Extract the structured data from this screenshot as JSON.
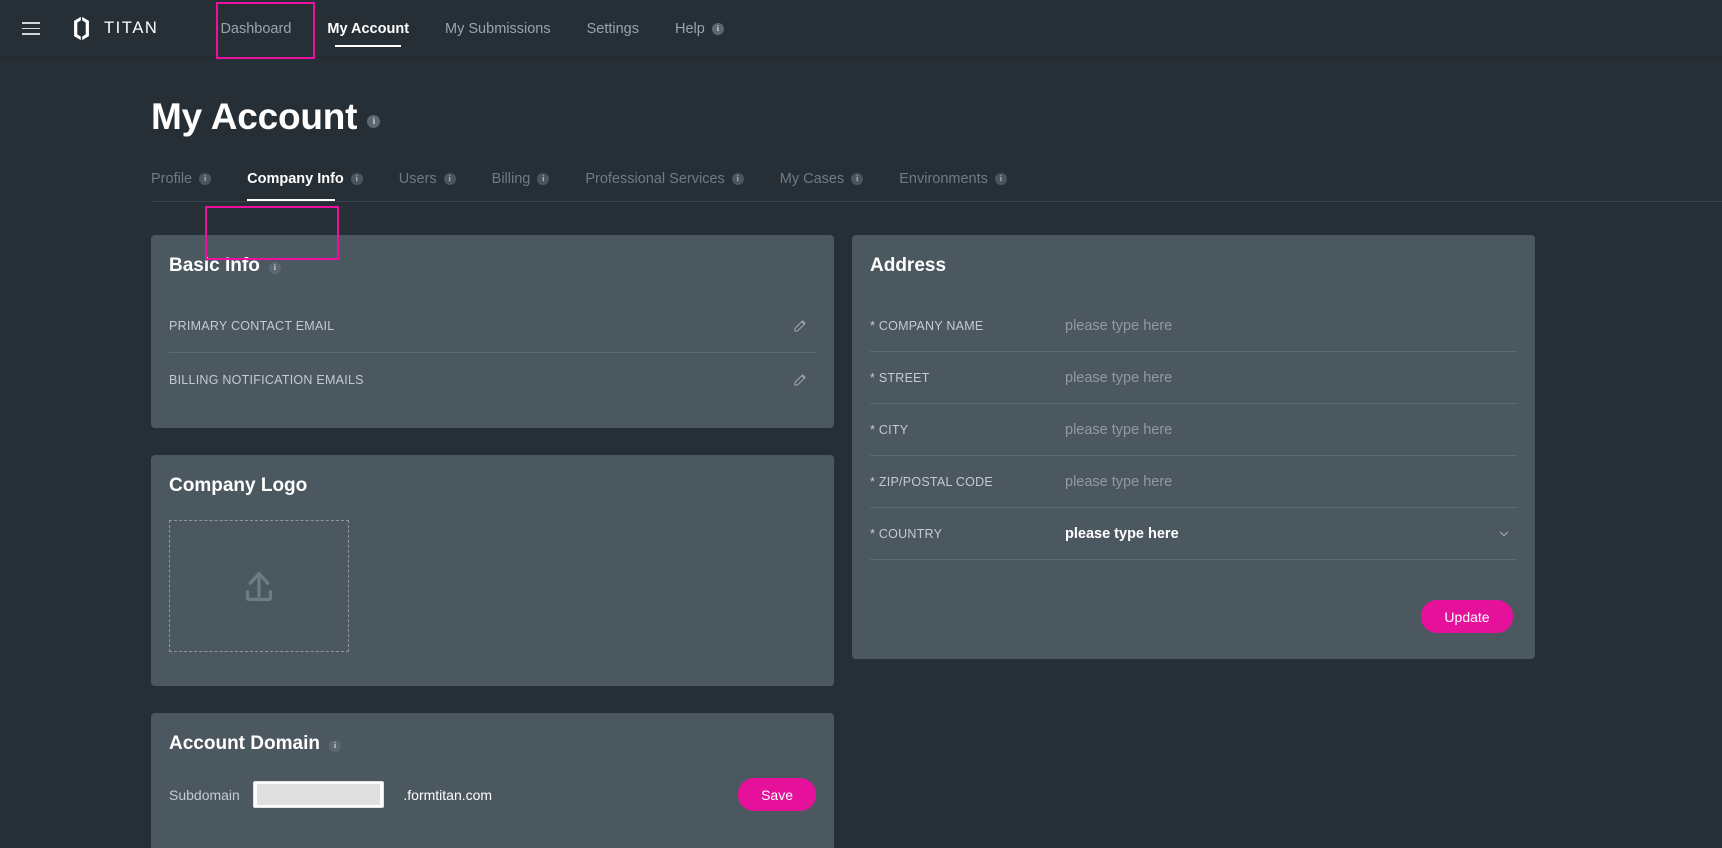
{
  "topnav": {
    "brand": "TITAN",
    "menu_icon": "hamburger-icon",
    "links": [
      {
        "label": "Dashboard",
        "active": false,
        "info": false
      },
      {
        "label": "My Account",
        "active": true,
        "info": false
      },
      {
        "label": "My Submissions",
        "active": false,
        "info": false
      },
      {
        "label": "Settings",
        "active": false,
        "info": false
      },
      {
        "label": "Help",
        "active": false,
        "info": true
      }
    ]
  },
  "page": {
    "title": "My Account",
    "title_info": "i"
  },
  "tabs": [
    {
      "label": "Profile",
      "active": false,
      "info": true
    },
    {
      "label": "Company Info",
      "active": true,
      "info": true
    },
    {
      "label": "Users",
      "active": false,
      "info": true
    },
    {
      "label": "Billing",
      "active": false,
      "info": true
    },
    {
      "label": "Professional Services",
      "active": false,
      "info": true
    },
    {
      "label": "My Cases",
      "active": false,
      "info": true
    },
    {
      "label": "Environments",
      "active": false,
      "info": true
    }
  ],
  "basic_info": {
    "title": "Basic Info",
    "rows": [
      {
        "label": "PRIMARY CONTACT EMAIL",
        "value": "",
        "edit_icon": "pencil-icon"
      },
      {
        "label": "BILLING NOTIFICATION EMAILS",
        "value": "",
        "edit_icon": "pencil-icon"
      }
    ]
  },
  "company_logo": {
    "title": "Company Logo",
    "upload_icon": "upload-icon"
  },
  "account_domain": {
    "title": "Account Domain",
    "subdomain_label": "Subdomain",
    "subdomain_value": "",
    "suffix": ".formtitan.com",
    "save_label": "Save"
  },
  "address": {
    "title": "Address",
    "placeholder": "please type here",
    "fields": [
      {
        "label": "* COMPANY NAME",
        "value": "please type here",
        "type": "text",
        "filled": false
      },
      {
        "label": "* STREET",
        "value": "please type here",
        "type": "text",
        "filled": false
      },
      {
        "label": "* CITY",
        "value": "please type here",
        "type": "text",
        "filled": false
      },
      {
        "label": "* ZIP/POSTAL CODE",
        "value": "please type here",
        "type": "text",
        "filled": false
      },
      {
        "label": "* COUNTRY",
        "value": "please type here",
        "type": "select",
        "filled": true
      }
    ],
    "update_label": "Update"
  },
  "colors": {
    "page_bg": "#272f36",
    "card_bg": "#4c585f",
    "accent": "#e6119b",
    "highlight": "#ec10a0",
    "text_primary": "#ffffff",
    "text_muted": "#8f9aa1"
  }
}
